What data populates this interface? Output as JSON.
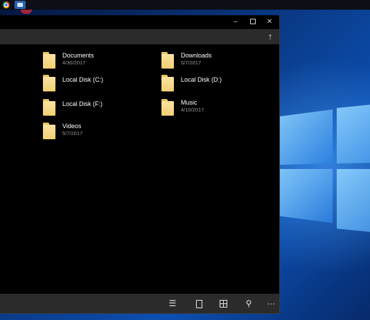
{
  "taskbar": {
    "icons": [
      {
        "name": "chrome-icon"
      },
      {
        "name": "files-app-icon"
      }
    ]
  },
  "window": {
    "caption": {
      "minimize": "–",
      "maximize": "",
      "close": "✕"
    },
    "address": {
      "up_button": "↑"
    },
    "items": [
      {
        "name": "Documents",
        "date": "4/30/2017"
      },
      {
        "name": "Downloads",
        "date": "5/7/2017"
      },
      {
        "name": "Local Disk (C:)",
        "date": ""
      },
      {
        "name": "Local Disk (D:)",
        "date": ""
      },
      {
        "name": "Local Disk (F:)",
        "date": ""
      },
      {
        "name": "Music",
        "date": "4/10/2017"
      },
      {
        "name": "Videos",
        "date": "5/7/2017"
      }
    ],
    "commandbar": {
      "select": "☰",
      "search": "⚲",
      "more": "···"
    }
  },
  "colors": {
    "window_bg": "#000000",
    "bar_bg": "#2b2b2b",
    "folder": "#f2cf72",
    "wallpaper_accent": "#0c4fb2"
  }
}
